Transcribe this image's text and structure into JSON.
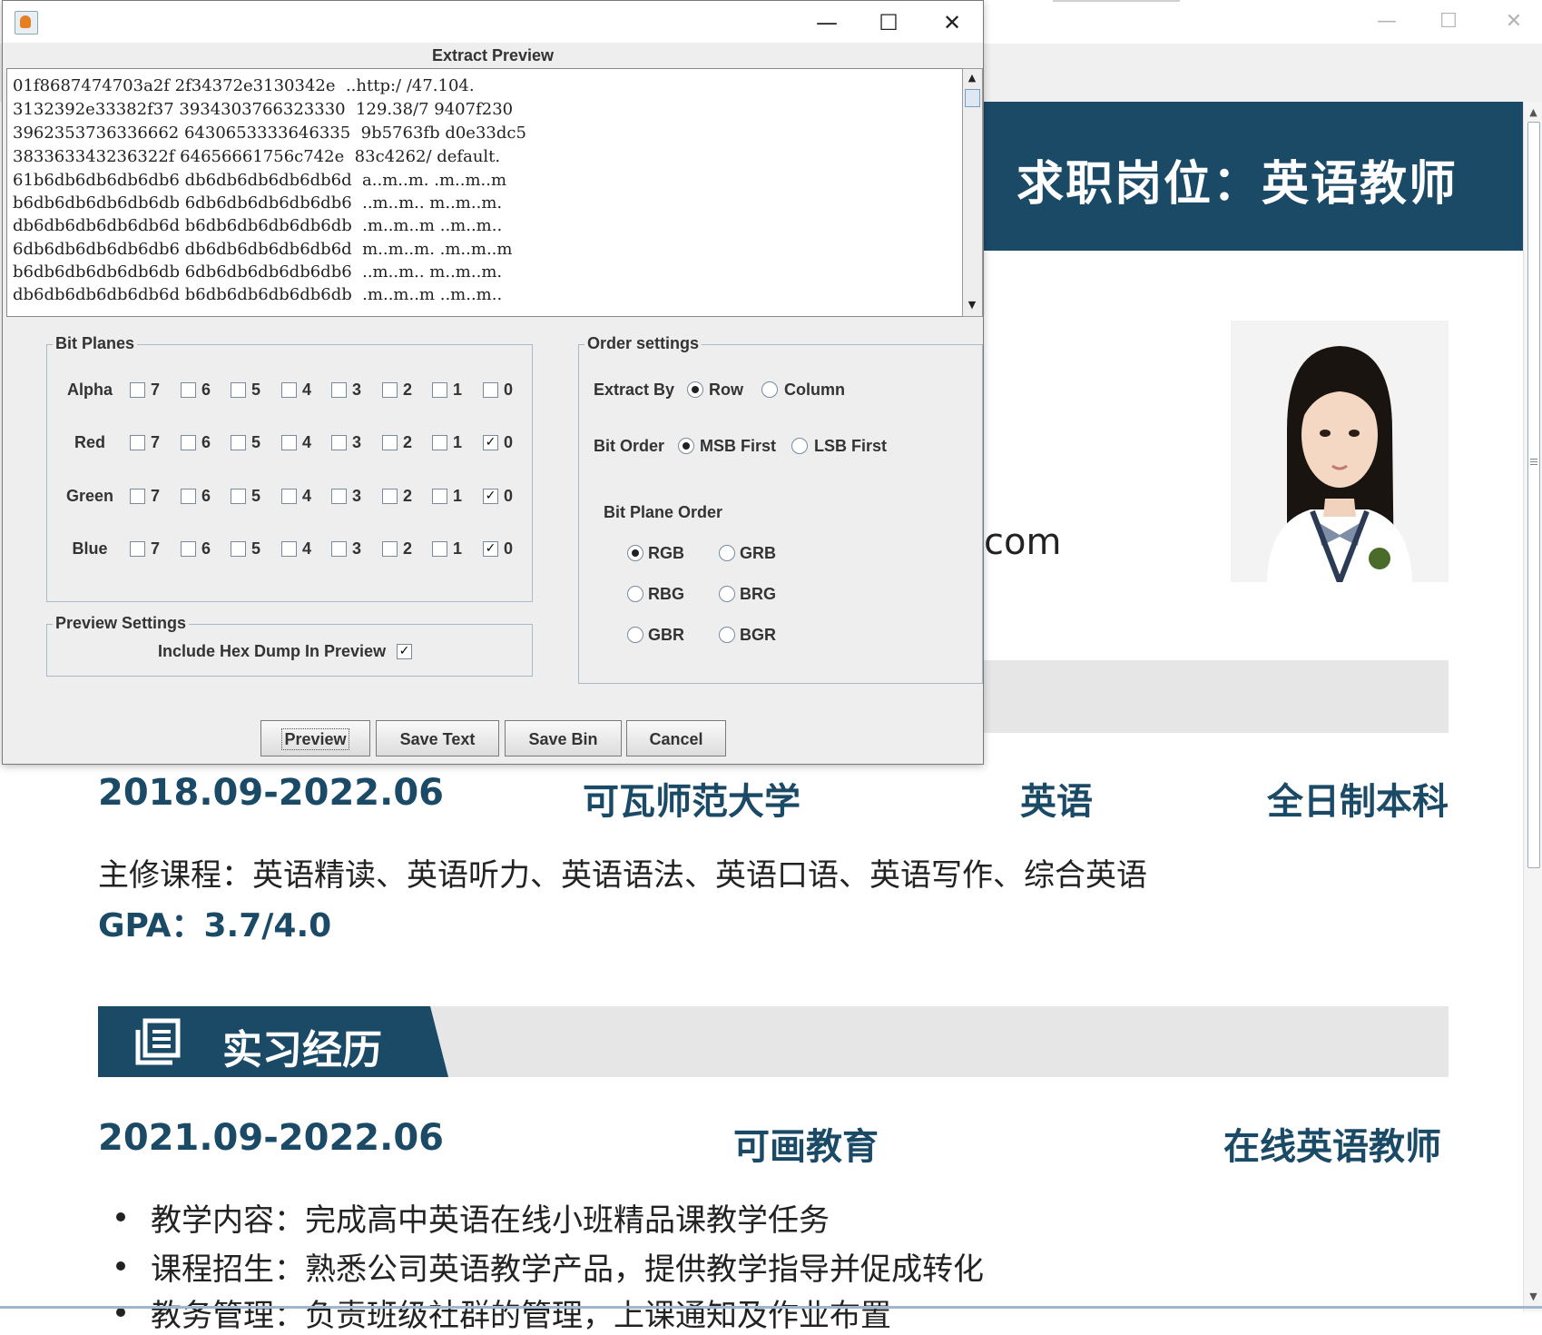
{
  "dialog": {
    "heading": "Extract Preview",
    "hex_lines": [
      "01f8687474703a2f 2f34372e3130342e  ..http:/ /47.104.",
      "3132392e33382f37 3934303766323330  129.38/7 9407f230",
      "3962353736336662 6430653333646335  9b5763fb d0e33dc5",
      "383363343236322f 64656661756c742e  83c4262/ default.",
      "61b6db6db6db6db6 db6db6db6db6db6d  a..m..m. .m..m..m",
      "b6db6db6db6db6db 6db6db6db6db6db6  ..m..m.. m..m..m.",
      "db6db6db6db6db6d b6db6db6db6db6db  .m..m..m ..m..m..",
      "6db6db6db6db6db6 db6db6db6db6db6d  m..m..m. .m..m..m",
      "b6db6db6db6db6db 6db6db6db6db6db6  ..m..m.. m..m..m.",
      "db6db6db6db6db6d b6db6db6db6db6db  .m..m..m ..m..m.."
    ],
    "bit_planes": {
      "title": "Bit Planes",
      "bits": [
        "7",
        "6",
        "5",
        "4",
        "3",
        "2",
        "1",
        "0"
      ],
      "rows": [
        {
          "label": "Alpha",
          "checked": [
            false,
            false,
            false,
            false,
            false,
            false,
            false,
            false
          ]
        },
        {
          "label": "Red",
          "checked": [
            false,
            false,
            false,
            false,
            false,
            false,
            false,
            true
          ]
        },
        {
          "label": "Green",
          "checked": [
            false,
            false,
            false,
            false,
            false,
            false,
            false,
            true
          ]
        },
        {
          "label": "Blue",
          "checked": [
            false,
            false,
            false,
            false,
            false,
            false,
            false,
            true
          ]
        }
      ]
    },
    "preview_settings": {
      "title": "Preview Settings",
      "include_hex_label": "Include Hex Dump In Preview",
      "include_hex_checked": true
    },
    "order_settings": {
      "title": "Order settings",
      "extract_by_label": "Extract By",
      "extract_by_options": [
        "Row",
        "Column"
      ],
      "extract_by_selected": "Row",
      "bit_order_label": "Bit Order",
      "bit_order_options": [
        "MSB First",
        "LSB First"
      ],
      "bit_order_selected": "MSB First",
      "plane_order_label": "Bit Plane Order",
      "plane_order_options": [
        "RGB",
        "GRB",
        "RBG",
        "BRG",
        "GBR",
        "BGR"
      ],
      "plane_order_selected": "RGB"
    },
    "buttons": {
      "preview": "Preview",
      "save_text": "Save Text",
      "save_bin": "Save Bin",
      "cancel": "Cancel"
    },
    "check_glyph": "✓"
  },
  "resume": {
    "job_title": "求职岗位：英语教师",
    "email_fragment": "com",
    "education": {
      "period": "2018.09-2022.06",
      "school": "可瓦师范大学",
      "major": "英语",
      "degree": "全日制本科",
      "courses": "主修课程：英语精读、英语听力、英语语法、英语口语、英语写作、综合英语",
      "gpa": "GPA：3.7/4.0"
    },
    "internship_section_title": "实习经历",
    "internship": {
      "period": "2021.09-2022.06",
      "company": "可画教育",
      "role": "在线英语教师",
      "bullets": [
        "教学内容：完成高中英语在线小班精品课教学任务",
        "课程招生：熟悉公司英语教学产品，提供教学指导并促成转化",
        "教务管理：负责班级社群的管理，上课通知及作业布置"
      ]
    }
  },
  "icons": {
    "minimize": "minimize-icon",
    "maximize": "maximize-icon",
    "close": "close-icon",
    "app": "java-app-icon",
    "section": "document-icon"
  },
  "colors": {
    "resume_accent": "#1b4a67",
    "dialog_bg": "#eeeeee",
    "group_border": "#a9b9cc"
  }
}
